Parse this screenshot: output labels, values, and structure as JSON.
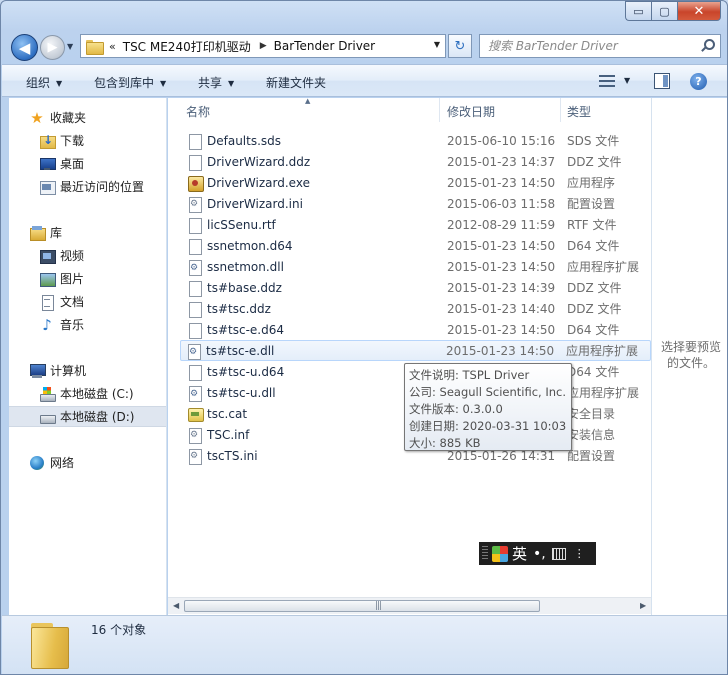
{
  "window": {
    "caption_buttons": {
      "minimize": "▭",
      "maximize": "▢",
      "close": "✕"
    }
  },
  "nav": {
    "back": "◀",
    "forward": "▶",
    "dropdown": "▼"
  },
  "address": {
    "chevron": "«",
    "crumbs": [
      "TSC ME240打印机驱动",
      "BarTender Driver"
    ],
    "separator": "▶",
    "dropdown": "▼",
    "refresh": "↻"
  },
  "search": {
    "placeholder": "搜索 BarTender Driver"
  },
  "toolbar": {
    "organize": "组织",
    "include_in_library": "包含到库中",
    "share": "共享",
    "new_folder": "新建文件夹",
    "dropdown": "▼",
    "help": "?"
  },
  "sidebar": {
    "favorites": "收藏夹",
    "downloads": "下载",
    "desktop": "桌面",
    "recent": "最近访问的位置",
    "libraries": "库",
    "videos": "视频",
    "pictures": "图片",
    "documents": "文档",
    "music": "音乐",
    "computer": "计算机",
    "drive_c": "本地磁盘 (C:)",
    "drive_d": "本地磁盘 (D:)",
    "network": "网络",
    "icons": {
      "star": "★",
      "music": "♪"
    }
  },
  "columns": {
    "name": "名称",
    "modified": "修改日期",
    "type": "类型",
    "sort_indicator": "▲"
  },
  "files": [
    {
      "name": "Defaults.sds",
      "date": "2015-06-10 15:16",
      "type": "SDS 文件",
      "icon": "plain"
    },
    {
      "name": "DriverWizard.ddz",
      "date": "2015-01-23 14:37",
      "type": "DDZ 文件",
      "icon": "plain"
    },
    {
      "name": "DriverWizard.exe",
      "date": "2015-01-23 14:50",
      "type": "应用程序",
      "icon": "exe"
    },
    {
      "name": "DriverWizard.ini",
      "date": "2015-06-03 11:58",
      "type": "配置设置",
      "icon": "ini"
    },
    {
      "name": "licSSenu.rtf",
      "date": "2012-08-29 11:59",
      "type": "RTF 文件",
      "icon": "plain"
    },
    {
      "name": "ssnetmon.d64",
      "date": "2015-01-23 14:50",
      "type": "D64 文件",
      "icon": "plain"
    },
    {
      "name": "ssnetmon.dll",
      "date": "2015-01-23 14:50",
      "type": "应用程序扩展",
      "icon": "dll"
    },
    {
      "name": "ts#base.ddz",
      "date": "2015-01-23 14:39",
      "type": "DDZ 文件",
      "icon": "plain"
    },
    {
      "name": "ts#tsc.ddz",
      "date": "2015-01-23 14:40",
      "type": "DDZ 文件",
      "icon": "plain"
    },
    {
      "name": "ts#tsc-e.d64",
      "date": "2015-01-23 14:50",
      "type": "D64 文件",
      "icon": "plain"
    },
    {
      "name": "ts#tsc-e.dll",
      "date": "2015-01-23 14:50",
      "type": "应用程序扩展",
      "icon": "dll"
    },
    {
      "name": "ts#tsc-u.d64",
      "date": "",
      "type": "D64 文件",
      "icon": "plain"
    },
    {
      "name": "ts#tsc-u.dll",
      "date": "",
      "type": "应用程序扩展",
      "icon": "dll"
    },
    {
      "name": "tsc.cat",
      "date": "",
      "type": "安全目录",
      "icon": "cat"
    },
    {
      "name": "TSC.inf",
      "date": "",
      "type": "安装信息",
      "icon": "ini"
    },
    {
      "name": "tscTS.ini",
      "date": "2015-01-26 14:31",
      "type": "配置设置",
      "icon": "ini"
    }
  ],
  "hover_index": 10,
  "tooltip": {
    "description": "文件说明: TSPL Driver",
    "company": "公司: Seagull Scientific, Inc.",
    "version": "文件版本: 0.3.0.0",
    "created": "创建日期: 2020-03-31 10:03",
    "size": "大小: 885 KB"
  },
  "scrollbar": {
    "left": "◀",
    "right": "▶",
    "grip": "|||"
  },
  "preview": {
    "message": "选择要预览的文件。"
  },
  "ime": {
    "language": "英",
    "punct": "•,",
    "options": "⋮"
  },
  "status": {
    "count": "16 个对象"
  }
}
